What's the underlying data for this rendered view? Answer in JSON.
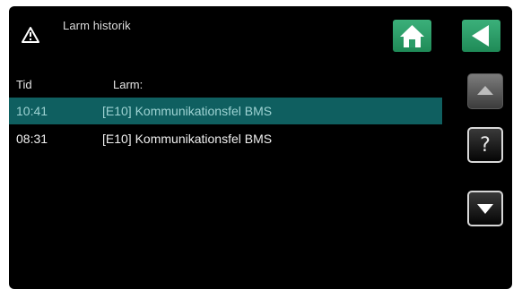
{
  "header": {
    "title": "Larm historik",
    "warning_icon": "warning-triangle-icon"
  },
  "table": {
    "columns": [
      "Tid",
      "Larm:"
    ],
    "rows": [
      {
        "time": "10:41",
        "message": "[E10] Kommunikationsfel BMS",
        "selected": true
      },
      {
        "time": "08:31",
        "message": "[E10] Kommunikationsfel BMS",
        "selected": false
      }
    ]
  },
  "buttons": {
    "home_icon": "home-icon",
    "back_icon": "back-arrow-icon",
    "up_icon": "scroll-up-icon",
    "help_label": "?",
    "down_icon": "scroll-down-icon"
  },
  "colors": {
    "screen_background": "#000000",
    "selected_row": "#0f5f60",
    "accent_green": "#2a9d68"
  }
}
